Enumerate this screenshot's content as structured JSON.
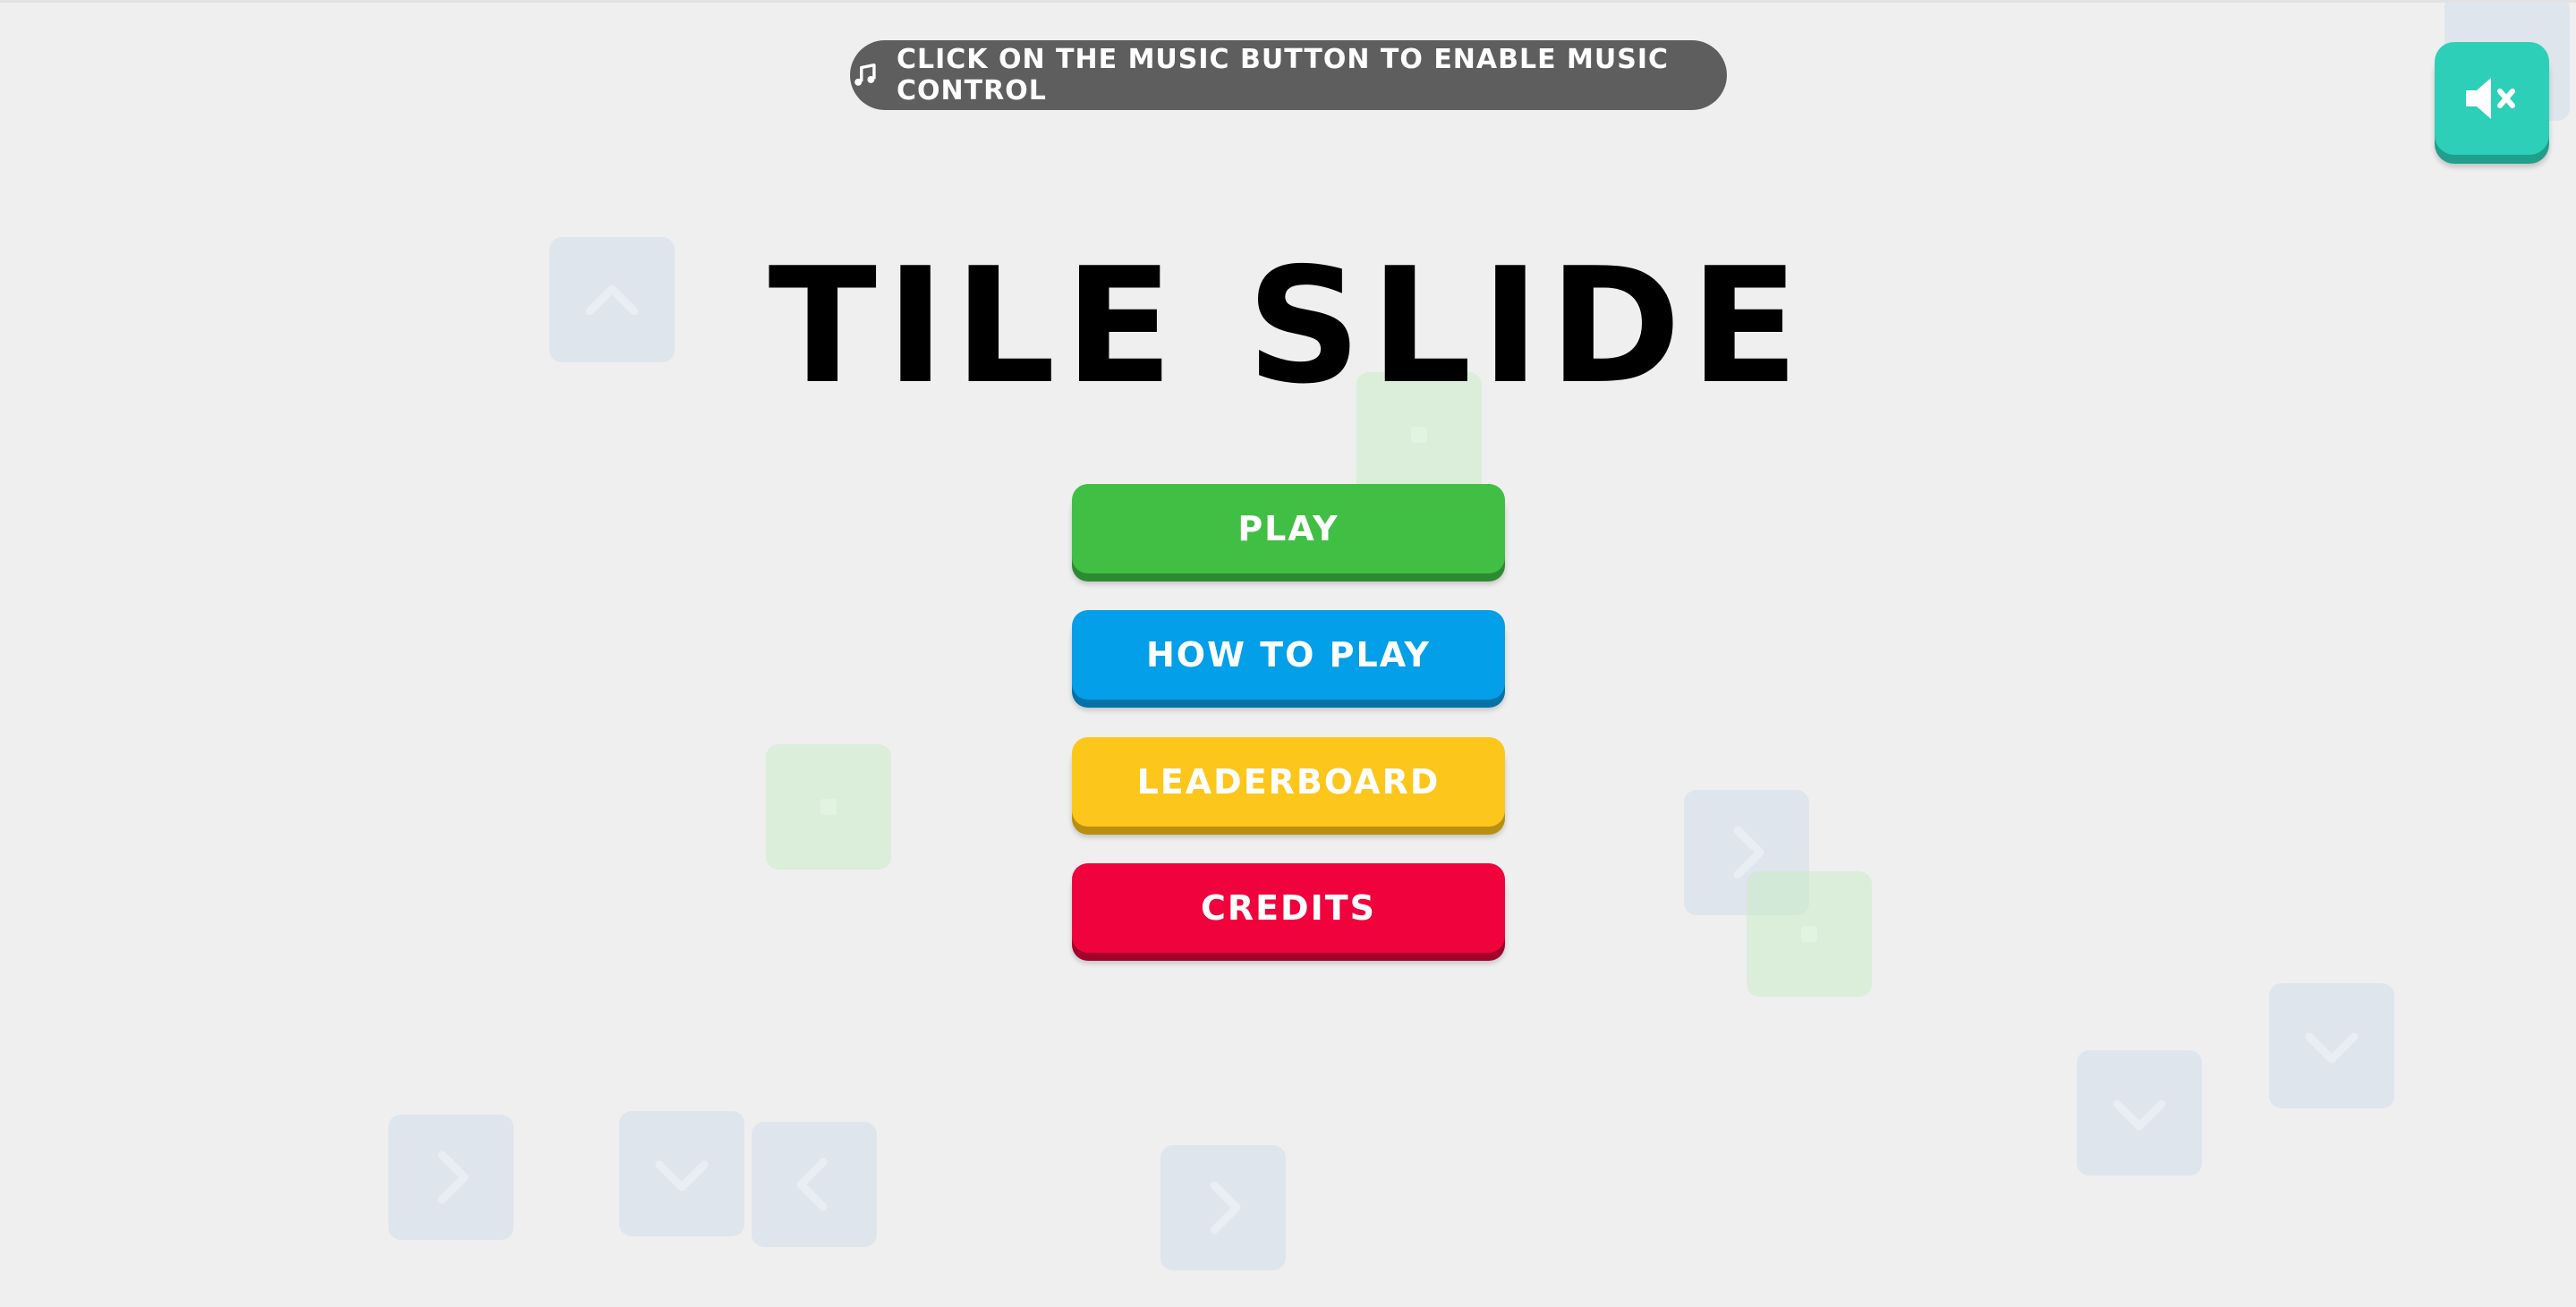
{
  "notice": {
    "text": "CLICK ON THE MUSIC BUTTON TO ENABLE MUSIC CONTROL",
    "icon": "music-note-icon"
  },
  "mute_button": {
    "icon": "speaker-muted-icon",
    "color": "#2ecfb8"
  },
  "title": "TILE SLIDE",
  "menu": {
    "play": "PLAY",
    "how_to_play": "HOW TO PLAY",
    "leaderboard": "LEADERBOARD",
    "credits": "CREDITS"
  },
  "colors": {
    "background": "#efefef",
    "play": "#41bf44",
    "how_to_play": "#039fe8",
    "leaderboard": "#fdc61a",
    "credits": "#f0023c"
  },
  "background_tiles": [
    {
      "color": "blue",
      "icon": "chevron-up-icon"
    },
    {
      "color": "green",
      "icon": "dot-icon"
    },
    {
      "color": "green",
      "icon": "dot-icon"
    },
    {
      "color": "blue",
      "icon": "chevron-right-icon"
    },
    {
      "color": "green",
      "icon": "dot-icon"
    },
    {
      "color": "blue",
      "icon": "chevron-down-icon"
    },
    {
      "color": "blue",
      "icon": "chevron-down-icon"
    },
    {
      "color": "blue",
      "icon": "chevron-right-icon"
    },
    {
      "color": "blue",
      "icon": "chevron-down-icon"
    },
    {
      "color": "blue",
      "icon": "chevron-left-icon"
    },
    {
      "color": "blue",
      "icon": "chevron-right-icon"
    },
    {
      "color": "blue",
      "icon": "blank-tile"
    }
  ]
}
